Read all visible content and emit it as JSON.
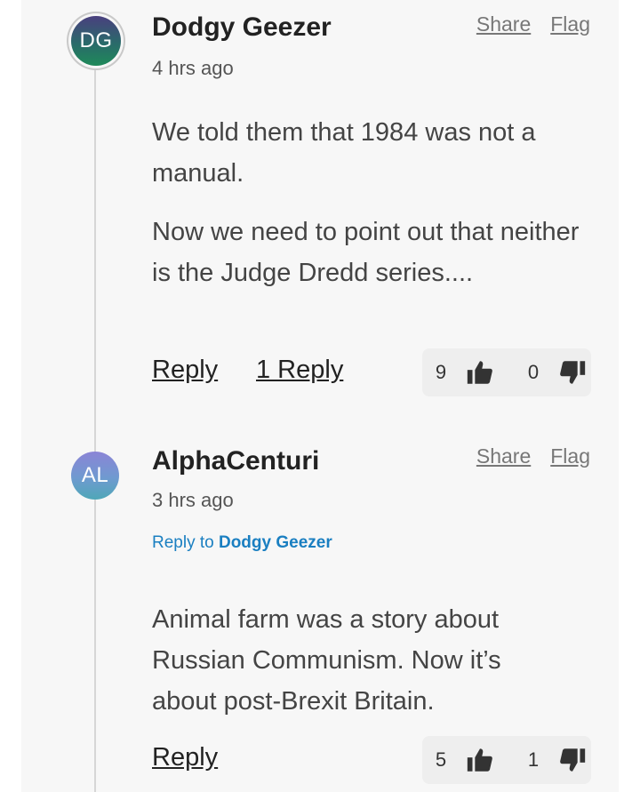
{
  "comments": [
    {
      "avatar_initials": "DG",
      "author": "Dodgy Geezer",
      "time": "4 hrs ago",
      "share_label": "Share",
      "flag_label": "Flag",
      "paragraphs": [
        "We told them that 1984 was not a manual.",
        "Now we need to point out that neither is the Judge Dredd series...."
      ],
      "reply_label": "Reply",
      "replies_label": "1 Reply",
      "upvotes": "9",
      "downvotes": "0",
      "upvote_icon": "thumbs-up-icon",
      "downvote_icon": "thumbs-down-icon"
    },
    {
      "avatar_initials": "AL",
      "author": "AlphaCenturi",
      "time": "3 hrs ago",
      "share_label": "Share",
      "flag_label": "Flag",
      "reply_to_prefix": "Reply to",
      "reply_to_name": "Dodgy Geezer",
      "paragraphs": [
        "Animal farm was a story about Russian Communism. Now it’s about post-Brexit Britain."
      ],
      "reply_label": "Reply",
      "upvotes": "5",
      "downvotes": "1",
      "upvote_icon": "thumbs-up-icon",
      "downvote_icon": "thumbs-down-icon"
    }
  ],
  "colors": {
    "link_blue": "#1a7fc1",
    "panel_bg": "#f7f7f7"
  }
}
